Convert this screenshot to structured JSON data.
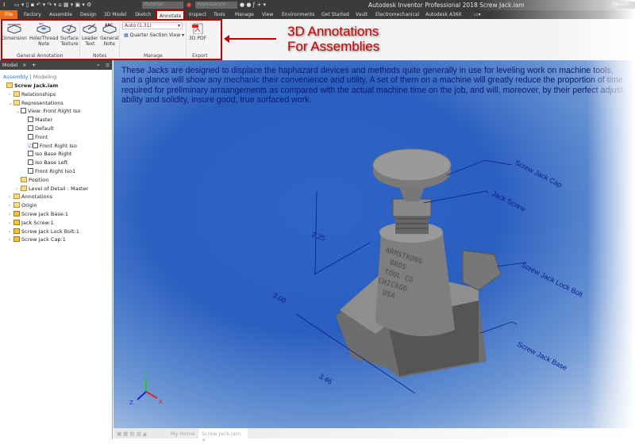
{
  "titlebar": {
    "title": "Autodesk Inventor Professional 2018    Screw Jack.iam",
    "material_placeholder": "Material",
    "appearance_placeholder": "Appearance",
    "search_placeholder": "Search"
  },
  "tabs": [
    "File",
    "Factory",
    "Assemble",
    "Design",
    "3D Model",
    "Sketch",
    "Annotate",
    "Inspect",
    "Tools",
    "Manage",
    "View",
    "Environments",
    "Get Started",
    "Vault",
    "Electromechanical",
    "Autodesk A360"
  ],
  "active_tab": "Annotate",
  "ribbon": {
    "buttons": [
      {
        "l1": "Dimension",
        "l2": ""
      },
      {
        "l1": "Hole/Thread",
        "l2": "Note"
      },
      {
        "l1": "Surface",
        "l2": "Texture"
      },
      {
        "l1": "Leader",
        "l2": "Text"
      },
      {
        "l1": "General",
        "l2": "Note"
      },
      {
        "l1": "3D PDF",
        "l2": ""
      }
    ],
    "scale_select": "Auto (1.31)",
    "section_view": "Quarter Section View",
    "groups": [
      "General Annotation",
      "Notes",
      "Manage",
      "Export"
    ]
  },
  "callout": {
    "line1": "3D Annotations",
    "line2": "For Assemblies",
    "color": "#d00000"
  },
  "browser": {
    "tab": "Model",
    "assembly": "Assembly",
    "modeling": "Modeling",
    "items": [
      {
        "label": "Screw Jack.iam",
        "level": 0,
        "bold": true
      },
      {
        "label": "Relationships",
        "level": 1
      },
      {
        "label": "Representations",
        "level": 1
      },
      {
        "label": "View: Front Right Iso",
        "level": 2
      },
      {
        "label": "Master",
        "level": 3
      },
      {
        "label": "Default",
        "level": 3
      },
      {
        "label": "Front",
        "level": 3
      },
      {
        "label": "Front Right Iso",
        "level": 3,
        "checked": true
      },
      {
        "label": "Iso Base Right",
        "level": 3
      },
      {
        "label": "Iso Base Left",
        "level": 3
      },
      {
        "label": "Front Right Iso1",
        "level": 3
      },
      {
        "label": "Position",
        "level": 2
      },
      {
        "label": "Level of Detail : Master",
        "level": 2
      },
      {
        "label": "Annotations",
        "level": 1
      },
      {
        "label": "Origin",
        "level": 1
      },
      {
        "label": "Screw Jack Base:1",
        "level": 1
      },
      {
        "label": "Jack Screw:1",
        "level": 1
      },
      {
        "label": "Screw Jack Lock Bolt:1",
        "level": 1
      },
      {
        "label": "Screw Jack Cap:1",
        "level": 1
      }
    ]
  },
  "viewport": {
    "note": "These Jacks are designed to displace the haphazard devices and methods quite generally in use for leveling work on machine tools, and a glance will show any mechanic their convenience and utility.  A set of them on a machine will greatly reduce the proportion of time required for preliminary arraangements as compared with the actual machine time on the job, and will, moreover, by their perfect adjust-ability and solidity, insure good, true surfaced work.",
    "labels": {
      "cap": "Screw Jack Cap",
      "screw": "Jack Screw",
      "bolt": "Screw Jack Lock Bolt",
      "base": "Screw Jack Base"
    },
    "dims": {
      "height": "2.25",
      "depth": "3.00",
      "width": "3.46"
    },
    "engraving": [
      "ARMSTRONG",
      "BROS",
      "TOOL CO",
      "CHICAGO",
      "USA"
    ],
    "axes": {
      "x": "X",
      "y": "Y",
      "z": "Z"
    }
  },
  "doc_tabs": {
    "home": "My Home",
    "doc": "Screw Jack.iam"
  }
}
